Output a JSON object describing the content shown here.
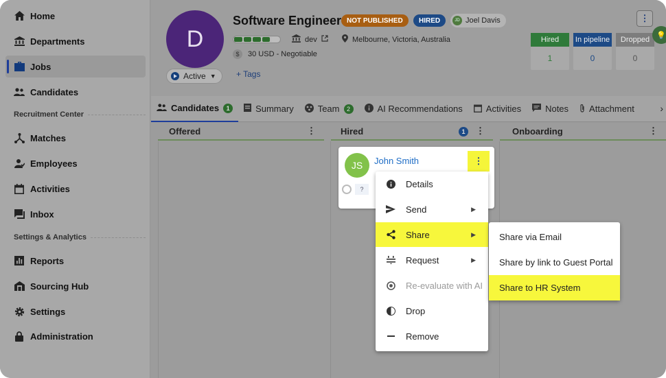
{
  "sidebar": {
    "items": [
      {
        "label": "Home",
        "icon": "home-icon"
      },
      {
        "label": "Departments",
        "icon": "bank-icon"
      },
      {
        "label": "Jobs",
        "icon": "briefcase-icon",
        "active": true
      },
      {
        "label": "Candidates",
        "icon": "people-icon"
      },
      {
        "label": "Matches",
        "icon": "match-icon"
      },
      {
        "label": "Employees",
        "icon": "employee-icon"
      },
      {
        "label": "Activities",
        "icon": "calendar-icon"
      },
      {
        "label": "Inbox",
        "icon": "inbox-icon"
      },
      {
        "label": "Reports",
        "icon": "chart-icon"
      },
      {
        "label": "Sourcing Hub",
        "icon": "sourcing-icon"
      },
      {
        "label": "Settings",
        "icon": "gear-icon"
      },
      {
        "label": "Administration",
        "icon": "lock-icon"
      }
    ],
    "sections": [
      "Recruitment Center",
      "Settings & Analytics"
    ]
  },
  "job": {
    "avatar_letter": "D",
    "title": "Software Engineer",
    "badge_status": "NOT PUBLISHED",
    "badge_stage": "HIRED",
    "owner_initials": "JD",
    "owner_name": "Joel Davis",
    "department": "dev",
    "location": "Melbourne, Victoria, Australia",
    "salary": "30 USD - Negotiable",
    "state": "Active",
    "tags_label": "+ Tags",
    "progress_filled": 4,
    "progress_total": 5
  },
  "stats": [
    {
      "label": "Hired",
      "value": "1",
      "color": "#2f7a3a"
    },
    {
      "label": "In pipeline",
      "value": "0",
      "color": "#1d4a86"
    },
    {
      "label": "Dropped",
      "value": "0",
      "color": "#7d7d7d"
    }
  ],
  "tabs": [
    {
      "label": "Candidates",
      "count": "1",
      "icon": "people-icon"
    },
    {
      "label": "Summary",
      "icon": "summary-icon"
    },
    {
      "label": "Team",
      "count": "2",
      "icon": "team-icon"
    },
    {
      "label": "AI Recommendations",
      "icon": "info-icon"
    },
    {
      "label": "Activities",
      "icon": "calendar-icon"
    },
    {
      "label": "Notes",
      "icon": "note-icon"
    },
    {
      "label": "Attachment",
      "icon": "paperclip-icon"
    }
  ],
  "columns": [
    {
      "label": "Offered"
    },
    {
      "label": "Hired",
      "count": "1"
    },
    {
      "label": "Onboarding"
    }
  ],
  "card": {
    "initials": "JS",
    "name": "John Smith",
    "question": "?"
  },
  "context_menu": [
    {
      "label": "Details",
      "icon": "info-icon"
    },
    {
      "label": "Send",
      "icon": "send-icon",
      "submenu": true
    },
    {
      "label": "Share",
      "icon": "share-icon",
      "submenu": true,
      "highlighted": true
    },
    {
      "label": "Request",
      "icon": "request-icon",
      "submenu": true
    },
    {
      "label": "Re-evaluate with AI",
      "icon": "ai-icon",
      "disabled": true
    },
    {
      "label": "Drop",
      "icon": "drop-icon"
    },
    {
      "label": "Remove",
      "icon": "minus-icon"
    }
  ],
  "share_submenu": [
    {
      "label": "Share via Email"
    },
    {
      "label": "Share by link to Guest Portal"
    },
    {
      "label": "Share to HR System",
      "highlighted": true
    }
  ],
  "colors": {
    "highlight": "#f7f73c",
    "accent": "#1e3d9a",
    "link": "#1e6dc6"
  }
}
